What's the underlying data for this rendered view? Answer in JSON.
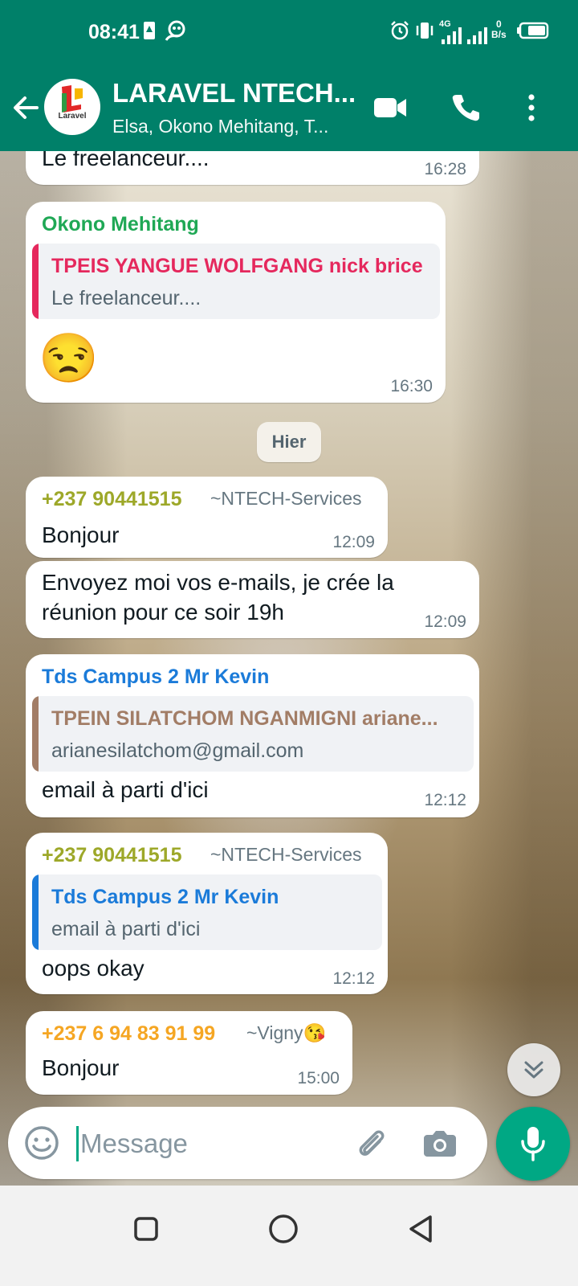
{
  "status_bar": {
    "time": "08:41",
    "network": "4G",
    "speed_value": "0",
    "speed_unit": "B/s"
  },
  "header": {
    "title": "LARAVEL NTECH...",
    "subtitle": "Elsa, Okono Mehitang, T...",
    "avatar_text": "Laravel",
    "icons": [
      "back-arrow-icon",
      "video-call-icon",
      "voice-call-icon",
      "more-vert-icon"
    ]
  },
  "colors": {
    "header": "#008069",
    "accent": "#00a884",
    "sender_green": "#1fa855",
    "sender_olive": "#9da829",
    "sender_blue": "#1b7bd9",
    "sender_orange": "#f5a623",
    "quote_pink": "#e5285d",
    "quote_brown": "#a27d66"
  },
  "messages": [
    {
      "text": "Le freelanceur....",
      "time": "16:28"
    },
    {
      "sender": "Okono Mehitang",
      "quote": {
        "name": "TPEIS YANGUE WOLFGANG nick brice",
        "text": "Le freelanceur...."
      },
      "emoji": "😒",
      "time": "16:30"
    },
    {
      "sender": "+237 90441515",
      "pushname": "~NTECH-Services",
      "text": "Bonjour",
      "time": "12:09"
    },
    {
      "text_line1": "Envoyez moi vos e-mails, je crée la",
      "text_line2": "réunion pour ce soir 19h",
      "time": "12:09"
    },
    {
      "sender": "Tds Campus 2 Mr Kevin",
      "quote": {
        "name": "TPEIN SILATCHOM NGANMIGNI ariane...",
        "text": "arianesilatchom@gmail.com"
      },
      "text": "email à parti d'ici",
      "time": "12:12"
    },
    {
      "sender": "+237 90441515",
      "pushname": "~NTECH-Services",
      "quote": {
        "name": "Tds Campus 2 Mr Kevin",
        "text": "email à parti d'ici"
      },
      "text": "oops okay",
      "time": "12:12"
    },
    {
      "sender": "+237 6 94 83 91 99",
      "pushname": "~Vigny😘",
      "text": "Bonjour",
      "time": "15:00"
    }
  ],
  "date_chip": "Hier",
  "composer": {
    "placeholder": "Message",
    "value": ""
  }
}
